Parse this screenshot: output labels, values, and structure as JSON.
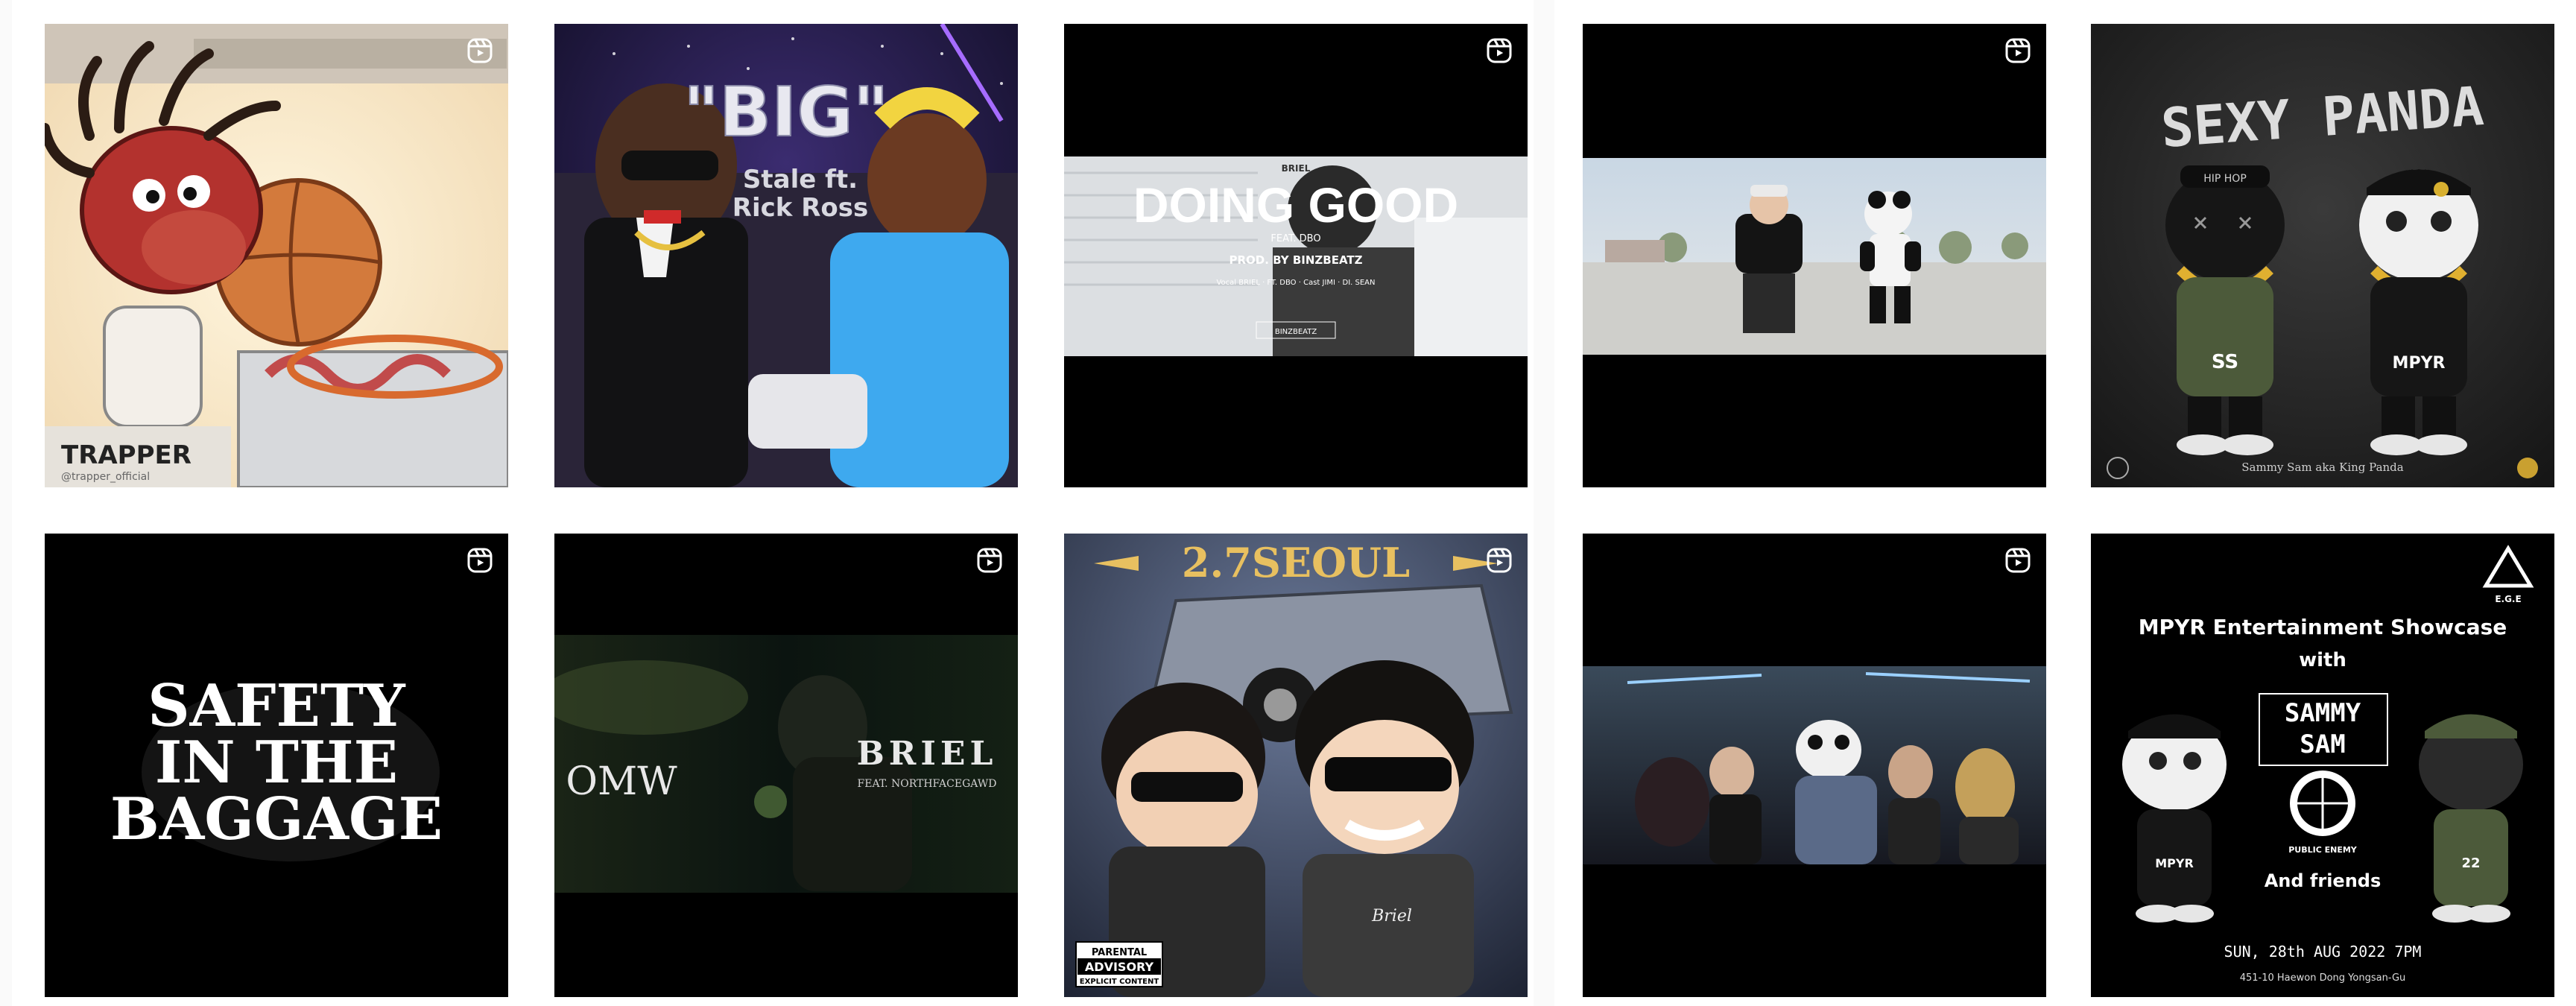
{
  "grid": {
    "icon": "reels-icon",
    "tiles": [
      {
        "id": "trapper",
        "scene": "cartoon-basketball-character",
        "texts": {
          "brand": "TRAPPER",
          "handle": "@trapper_official"
        }
      },
      {
        "id": "big",
        "scene": "3d-avatars-in-car",
        "texts": {
          "title": "\"BIG\"",
          "sub1": "Stale ft.",
          "sub2": "Rick Ross"
        }
      },
      {
        "id": "doing-good",
        "scene": "letterboxed-video-frame",
        "texts": {
          "artist": "BRIEL",
          "title": "DOING GOOD",
          "feat": "FEAT. DBO",
          "prod": "PROD. BY BINZBEATZ",
          "credits": "Vocal BRIEL · FT. DBO · Cast JIMI · DI. SEAN",
          "logo": "BINZBEATZ"
        }
      },
      {
        "id": "panda-video",
        "scene": "man-and-panda-outdoor-video",
        "texts": {}
      },
      {
        "id": "sexy-panda",
        "scene": "panda-toy-figures-poster",
        "texts": {
          "title": "SEXY PANDA",
          "footer": "Sammy Sam aka King Panda",
          "tag_left": "SS",
          "tag_right": "MPYR",
          "cap_left": "HIP HOP"
        }
      },
      {
        "id": "safety",
        "scene": "black-title-card",
        "texts": {
          "line1": "SAFETY",
          "line2": "IN THE",
          "line3": "BAGGAGE"
        }
      },
      {
        "id": "omw",
        "scene": "dark-green-video-frame",
        "texts": {
          "title": "OMW",
          "artist": "BRIEL",
          "feat": "FEAT. NORTHFACEGAWD"
        }
      },
      {
        "id": "27seoul",
        "scene": "3d-characters-with-truck",
        "texts": {
          "title": "2.7SEOUL",
          "advisory1": "PARENTAL",
          "advisory2": "ADVISORY",
          "advisory3": "EXPLICIT CONTENT",
          "jacket": "Briel"
        }
      },
      {
        "id": "club-video",
        "scene": "club-scene-video-frame",
        "texts": {}
      },
      {
        "id": "showcase",
        "scene": "event-flyer",
        "texts": {
          "logo": "E.G.E",
          "headline": "MPYR Entertainment Showcase",
          "with": "with",
          "name1": "SAMMY",
          "name2": "SAM",
          "public_enemy": "PUBLIC ENEMY",
          "friends": "And friends",
          "date": "SUN, 28th AUG 2022 7PM",
          "address": "451-10 Haewon Dong Yongsan-Gu",
          "fig_left": "MPYR",
          "fig_right": "22"
        }
      }
    ]
  },
  "colors": {
    "page_bg": "#fafafa",
    "panel_bg": "#ffffff",
    "icon": "#ffffff"
  }
}
